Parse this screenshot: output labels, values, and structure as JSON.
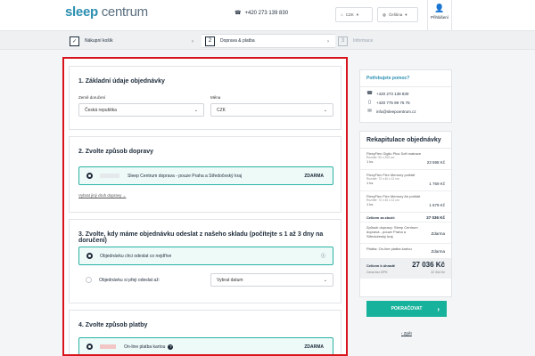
{
  "header": {
    "logo_sleep": "sleep",
    "logo_centrum": "centrum",
    "phone": "+420 273 139 830",
    "currency": "CZK",
    "language": "Čeština",
    "login": "Přihlášení"
  },
  "steps": [
    {
      "num": "",
      "label": "Nákupní košík"
    },
    {
      "num": "2",
      "label": "Doprava & platba"
    },
    {
      "num": "3",
      "label": "Informace"
    }
  ],
  "section1": {
    "title": "1. Základní údaje objednávky",
    "country_label": "Země doručení",
    "country_value": "Česká republika",
    "currency_label": "Měna",
    "currency_value": "CZK"
  },
  "section2": {
    "title": "2. Zvolte způsob dopravy",
    "option_label": "Sleep Centrum doprava - pouze Praha a Středočeský kraj",
    "option_price": "ZDARMA",
    "other_link": "Vybrat jiný druh dopravy"
  },
  "section3": {
    "title": "3. Zvolte, kdy máme objednávku odeslat z našeho skladu (počítejte s 1 až 3 dny na doručení)",
    "option1": "Objednávku chci odeslat co nejdříve",
    "option2": "Objednávku si přeji odeslat až:",
    "date_placeholder": "Vybrat datum"
  },
  "section4": {
    "title": "4. Zvolte způsob platby",
    "option_label": "On-line platba kartou",
    "option_price": "ZDARMA"
  },
  "help": {
    "title": "Potřebujete pomoc?",
    "phone1": "+420 273 139 830",
    "phone2": "+420 775 99 75 76",
    "email": "info@sleepcentrum.cz"
  },
  "summary": {
    "title": "Rekapitulace objednávky",
    "items": [
      {
        "name": "FlexyFlex Giglio Plus Soft matrace",
        "detail": "Rozměr: 90 x 200 cm",
        "qty": "1 ks",
        "price": "23 598 Kč"
      },
      {
        "name": "FlexyFlex Flex Memory polštář",
        "detail": "Rozměr: 72 x 40 x 12 cm",
        "qty": "1 ks",
        "price": "1 759 Kč"
      },
      {
        "name": "FlexyFlex Flex Memory Air polštář",
        "detail": "Rozměr: 72 x 40 x 12 cm",
        "qty": "1 ks",
        "price": "1 679 Kč"
      }
    ],
    "subtotal_label": "Celkem za zboží:",
    "subtotal": "27 036 Kč",
    "shipping_label": "Způsob dopravy: Sleep Centrum doprava - pouze Praha a Středočeský kraj",
    "shipping_value": "Zdarma",
    "payment_label": "Platba: On-line platba kartou",
    "payment_value": "Zdarma",
    "total_label": "Celkem k úhradě",
    "total": "27 036 Kč",
    "novat_label": "Cena bez DPH",
    "novat": "22 344 Kč",
    "continue": "POKRAČOVAT",
    "back": "Zpět"
  }
}
